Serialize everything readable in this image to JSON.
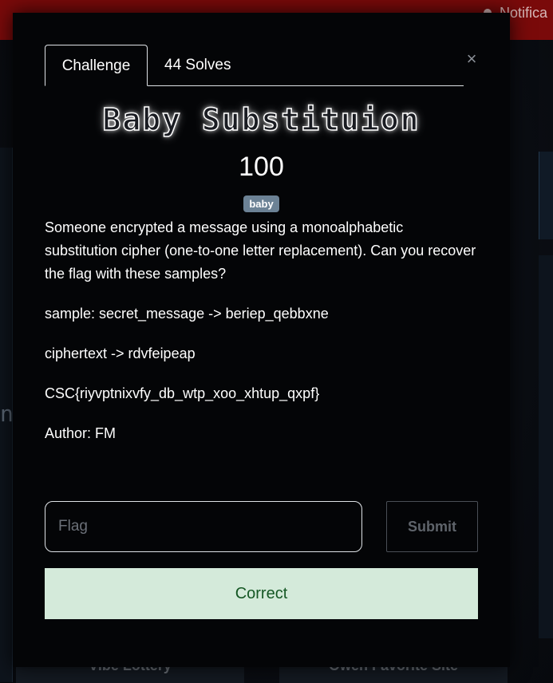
{
  "background": {
    "notification_label": "Notifica",
    "card_left_label": "Vibe Lottery",
    "card_right_label": "Owen Favorite Site",
    "side_letter": "n"
  },
  "modal": {
    "tabs": [
      {
        "label": "Challenge",
        "active": true
      },
      {
        "label": "44 Solves",
        "active": false
      }
    ],
    "close_symbol": "×",
    "title": "Baby Substituion",
    "points": "100",
    "tag": "baby",
    "description": [
      "Someone encrypted a message using a monoalphabetic substitution cipher (one-to-one letter replacement). Can you recover the flag with these samples?",
      "sample: secret_message -> beriep_qebbxne",
      "ciphertext -> rdvfeipeap",
      "CSC{riyvptnixvfy_db_wtp_xoo_xhtup_qxpf}",
      "Author: FM"
    ],
    "flag_input": {
      "placeholder": "Flag",
      "value": ""
    },
    "submit_label": "Submit",
    "result_message": "Correct"
  },
  "colors": {
    "top_bar": "#7a0a0a",
    "modal_bg": "#040507",
    "tag_bg": "#6c8295",
    "success_bg": "#d4eada",
    "success_text": "#155724"
  }
}
